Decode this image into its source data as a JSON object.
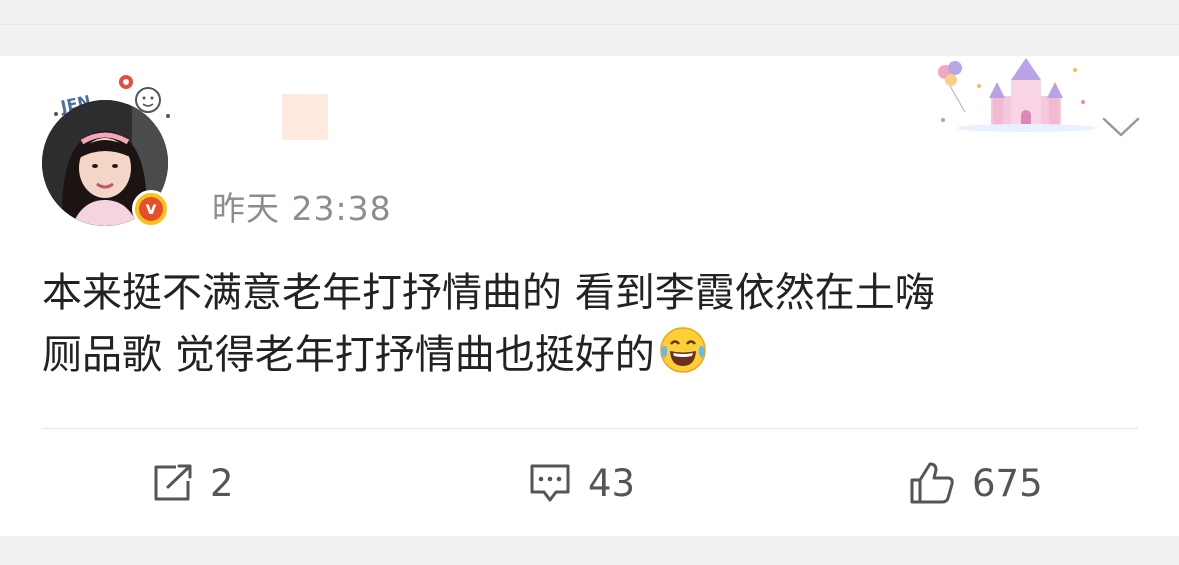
{
  "post": {
    "timestamp": "昨天 23:38",
    "badge_letter": "v",
    "text_line1": "本来挺不满意老年打抒情曲的 看到李霞依然在土嗨",
    "text_line2": "厕品歌 觉得老年打抒情曲也挺好的",
    "emoji": "laughing-with-tears"
  },
  "avatar_decoration_text": "JEN",
  "actions": {
    "repost_count": "2",
    "comment_count": "43",
    "like_count": "675"
  },
  "colors": {
    "badge_outer": "#f7c21b",
    "badge_inner": "#e5502b",
    "timestamp": "#8d8d8d",
    "text": "#222222",
    "action": "#555555"
  }
}
